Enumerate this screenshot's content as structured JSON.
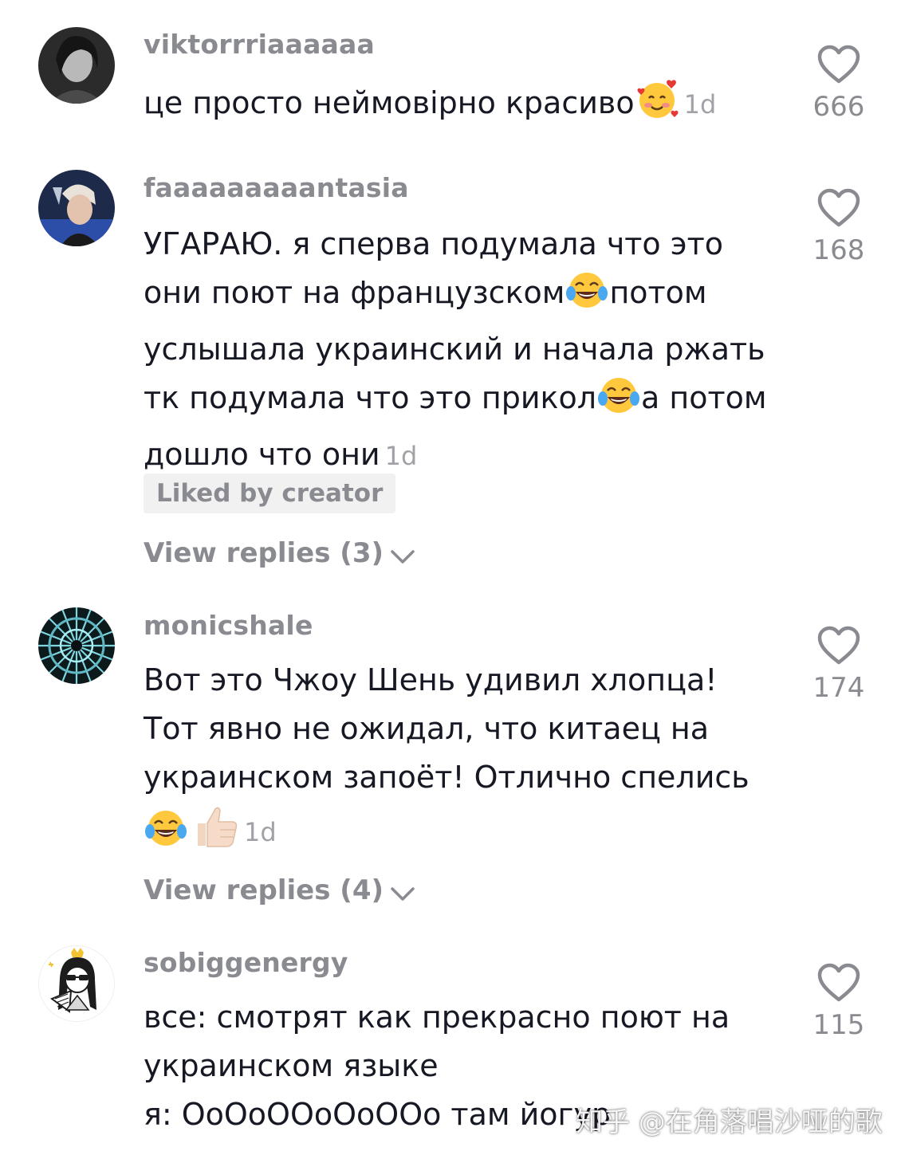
{
  "comments": [
    {
      "username": "viktorrriaaaaaa",
      "lines": [
        "це просто неймовірно красиво"
      ],
      "time": "1d",
      "likes": "666",
      "avatar_icon": "avatar-photo-icon"
    },
    {
      "username": "faaaaaaaaantasia",
      "lines": [
        "УГАРАЮ. я сперва подумала что это",
        "они поют на французском",
        "потом",
        "услышала украинский и начала ржать",
        "тк подумала что это прикол",
        "а потом",
        "дошло что они"
      ],
      "time": "1d",
      "likes": "168",
      "badge": "Liked by creator",
      "replies": "View replies (3)",
      "avatar_icon": "avatar-photo-icon"
    },
    {
      "username": "monicshale",
      "lines": [
        "Вот это Чжоу Шень удивил хлопца!",
        "Тот явно не ожидал, что китаец на",
        "украинском запоёт! Отлично спелись"
      ],
      "time": "1d",
      "likes": "174",
      "replies": "View replies (4)",
      "avatar_icon": "avatar-kaleidoscope-icon"
    },
    {
      "username": "sobiggenergy",
      "lines": [
        "все: смотрят как прекрасно поют на",
        "украинском языке",
        "я: ОоОоООоОоООо там йогур"
      ],
      "likes": "115",
      "avatar_icon": "avatar-cartoon-icon"
    }
  ],
  "icons": {
    "like": "heart-outline-icon",
    "replies": "chevron-down-icon",
    "emoji_smiling_hearts": "smiling-face-with-hearts-icon",
    "emoji_tears_of_joy": "face-with-tears-of-joy-icon",
    "emoji_thumbs_up": "thumbs-up-icon"
  },
  "watermark": "知乎 @在角落唱沙哑的歌",
  "colors": {
    "text": "#161823",
    "secondary": "#8a8b91",
    "badge_bg": "#f1f1f2"
  }
}
